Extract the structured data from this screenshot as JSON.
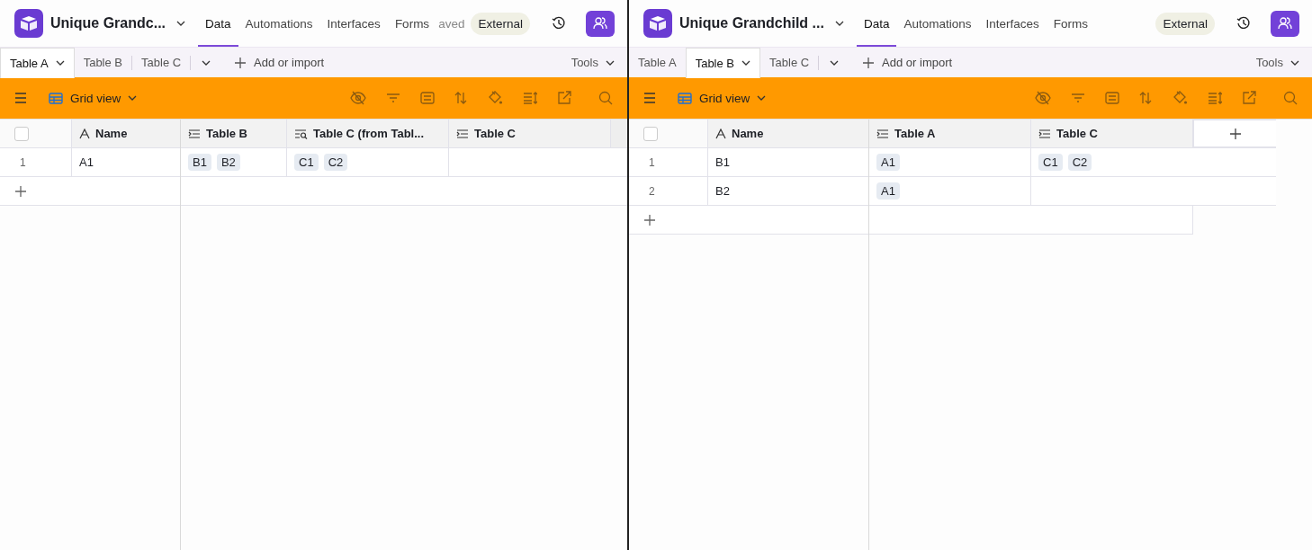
{
  "panes": [
    {
      "title": "Unique Grandc...",
      "nav": [
        {
          "label": "Data",
          "selected": true
        },
        {
          "label": "Automations",
          "selected": false
        },
        {
          "label": "Interfaces",
          "selected": false
        },
        {
          "label": "Forms",
          "selected": false
        }
      ],
      "status": "aved",
      "external": "External",
      "tables": [
        {
          "label": "Table A",
          "selected": true
        },
        {
          "label": "Table B",
          "selected": false
        },
        {
          "label": "Table C",
          "selected": false
        }
      ],
      "add_label": "Add or import",
      "tools_label": "Tools",
      "view_label": "Grid view",
      "select_all_checked": false,
      "columns": [
        {
          "name": "Name",
          "kind": "primary"
        },
        {
          "name": "Table B",
          "kind": "link"
        },
        {
          "name": "Table C (from Tabl...",
          "kind": "lookup"
        },
        {
          "name": "Table C",
          "kind": "link"
        }
      ],
      "rows": [
        {
          "number": "1",
          "cells": [
            "A1",
            [
              "B1",
              "B2"
            ],
            [
              "C1",
              "C2"
            ],
            ""
          ]
        }
      ]
    },
    {
      "title": "Unique Grandchild ...",
      "nav": [
        {
          "label": "Data",
          "selected": true
        },
        {
          "label": "Automations",
          "selected": false
        },
        {
          "label": "Interfaces",
          "selected": false
        },
        {
          "label": "Forms",
          "selected": false
        }
      ],
      "external": "External",
      "tables": [
        {
          "label": "Table A",
          "selected": false
        },
        {
          "label": "Table B",
          "selected": true
        },
        {
          "label": "Table C",
          "selected": false
        }
      ],
      "add_label": "Add or import",
      "tools_label": "Tools",
      "view_label": "Grid view",
      "select_all_checked": false,
      "columns": [
        {
          "name": "Name",
          "kind": "primary"
        },
        {
          "name": "Table A",
          "kind": "link"
        },
        {
          "name": "Table C",
          "kind": "link"
        }
      ],
      "rows": [
        {
          "number": "1",
          "cells": [
            "B1",
            [
              "A1"
            ],
            [
              "C1",
              "C2"
            ]
          ]
        },
        {
          "number": "2",
          "cells": [
            "B2",
            [
              "A1"
            ],
            ""
          ]
        }
      ]
    }
  ]
}
